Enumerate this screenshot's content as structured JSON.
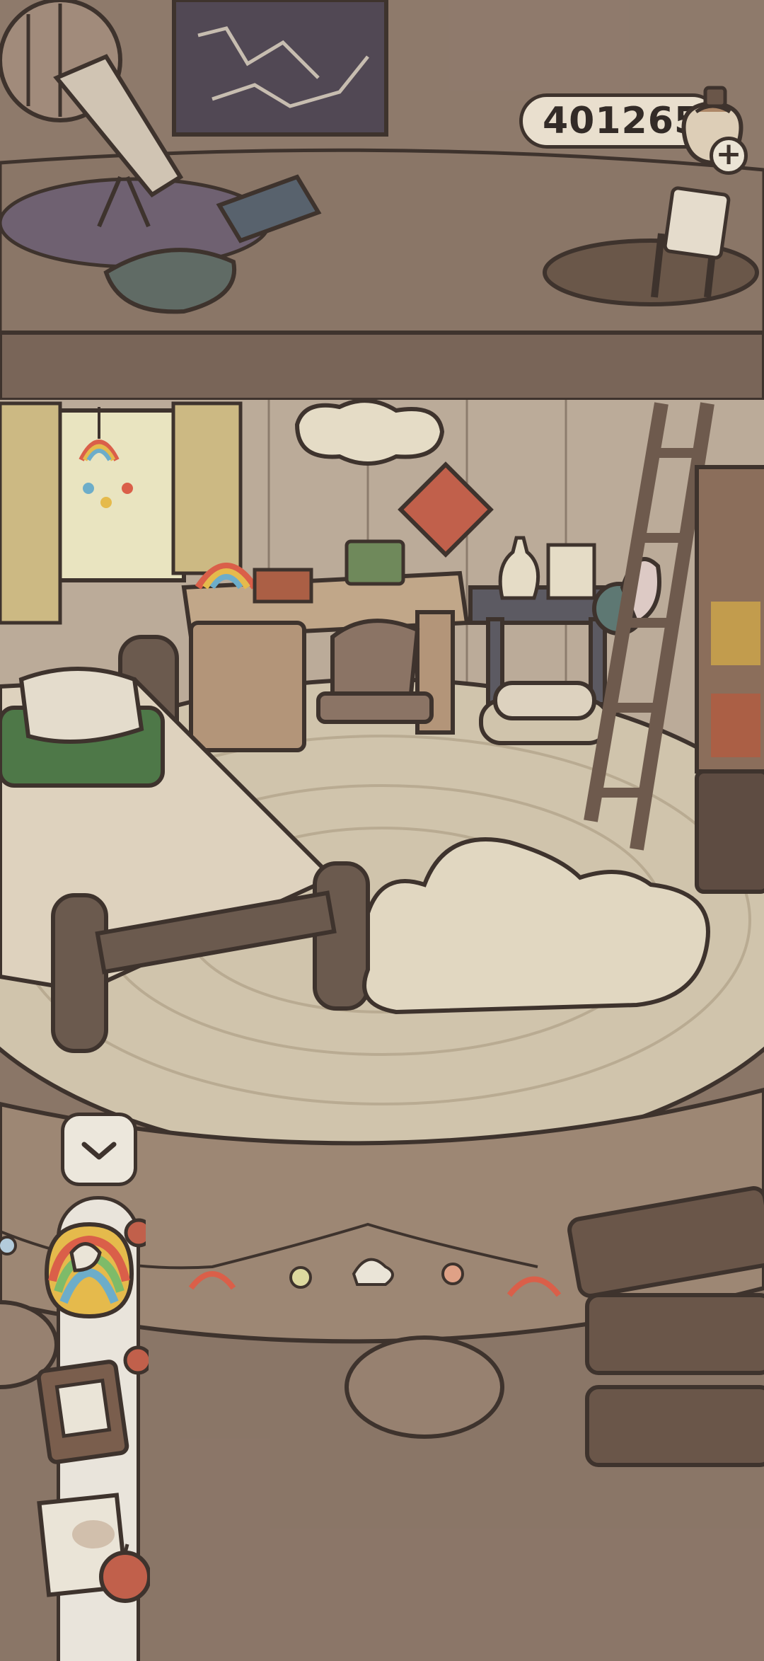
{
  "hud": {
    "currency_value": "401265",
    "currency_icon": "acorn-bag-icon",
    "add_currency_icon": "plus-icon"
  },
  "toolbar": {
    "collapse_icon": "chevron-down-icon",
    "tools": [
      {
        "icon": "rainbow-sticker-icon"
      },
      {
        "icon": "journal-icon"
      },
      {
        "icon": "letters-icon"
      }
    ]
  },
  "colors": {
    "wall": "#8d7869",
    "floor": "#d8ccb4",
    "wood_dark": "#6e5a4c",
    "outline": "#3a2f2a",
    "pill": "#f3ead8"
  }
}
